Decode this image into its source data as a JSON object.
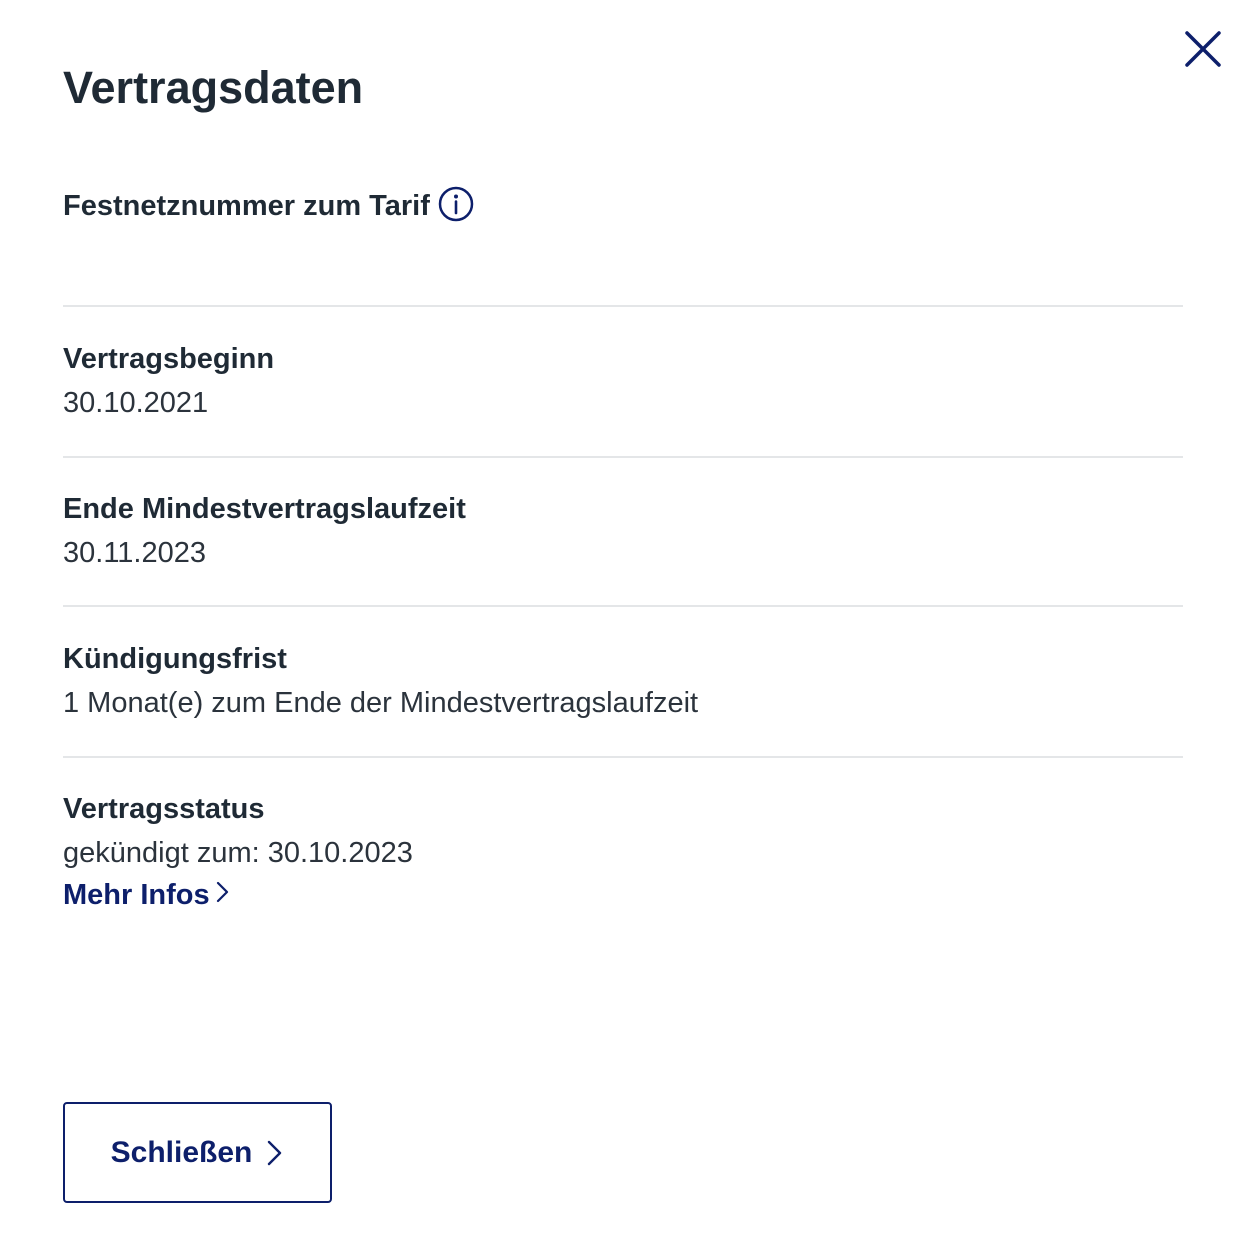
{
  "dialog": {
    "title": "Vertragsdaten",
    "close_icon": "close-icon"
  },
  "fields": {
    "phone_number": {
      "label": "Festnetznummer zum Tarif",
      "info_icon": "info-icon",
      "value": ""
    },
    "contract_start": {
      "label": "Vertragsbeginn",
      "value": "30.10.2021"
    },
    "min_term_end": {
      "label": "Ende Mindestvertragslaufzeit",
      "value": "30.11.2023"
    },
    "notice_period": {
      "label": "Kündigungsfrist",
      "value": "1 Monat(e) zum Ende der Mindestvertragslaufzeit"
    },
    "contract_status": {
      "label": "Vertragsstatus",
      "value": "gekündigt zum: 30.10.2023",
      "more_link": "Mehr Infos",
      "more_link_icon": "chevron-right-icon"
    }
  },
  "footer": {
    "close_button_label": "Schließen",
    "close_button_icon": "chevron-right-icon"
  },
  "colors": {
    "accent": "#0d1f6b",
    "text": "#1f2a35",
    "divider": "#e4e6e8"
  }
}
